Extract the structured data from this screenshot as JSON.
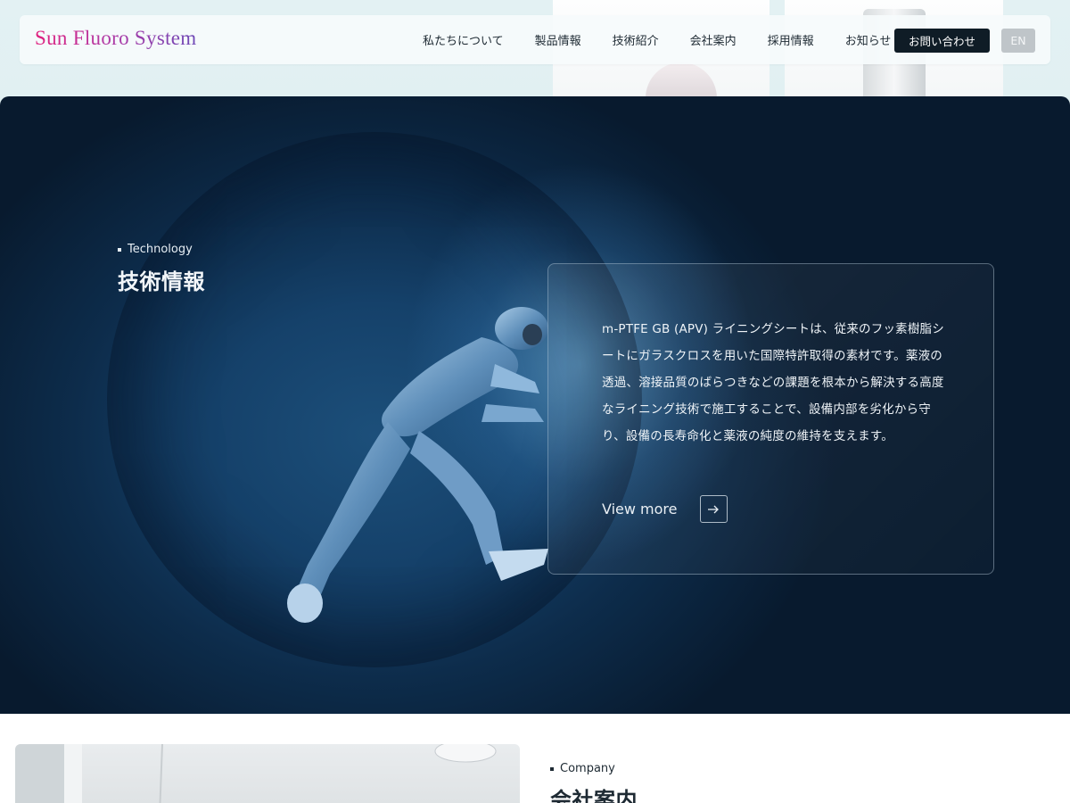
{
  "header": {
    "logo": "Sun Fluoro System",
    "nav": [
      "私たちについて",
      "製品情報",
      "技術紹介",
      "会社案内",
      "採用情報",
      "お知らせ"
    ],
    "contact_label": "お問い合わせ",
    "lang_label": "EN"
  },
  "technology": {
    "label": "Technology",
    "title": "技術情報",
    "body": "m-PTFE GB (APV) ライニングシートは、従来のフッ素樹脂シートにガラスクロスを用いた国際特許取得の素材です。薬液の透過、溶接品質のばらつきなどの課題を根本から解決する高度なライニング技術で施工することで、設備内部を劣化から守り、設備の長寿命化と薬液の純度の維持を支えます。",
    "view_more": "View more"
  },
  "company": {
    "label": "Company",
    "title": "会社案内"
  }
}
